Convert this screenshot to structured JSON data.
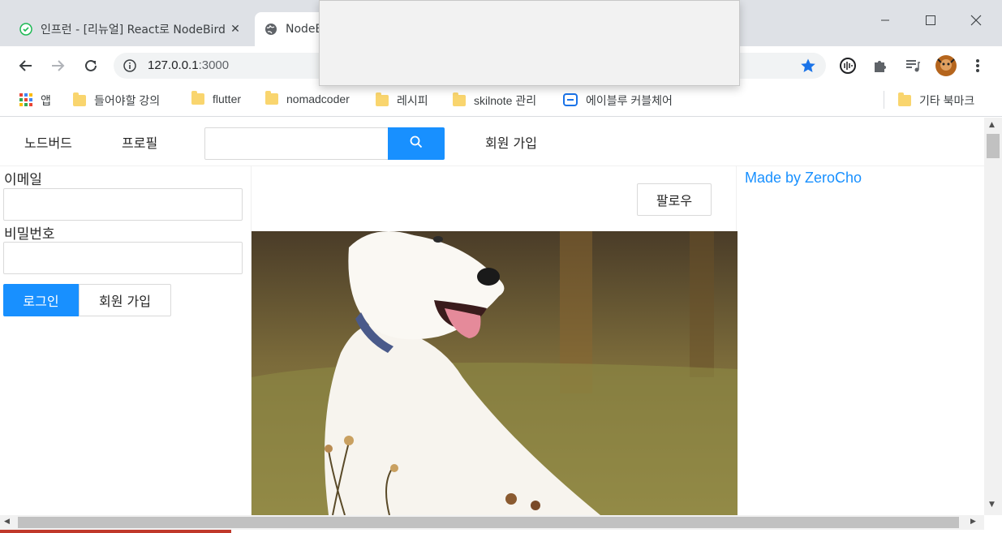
{
  "browser": {
    "tabs": [
      {
        "title": "인프런 - [리뉴얼] React로 NodeBird",
        "active": false
      },
      {
        "title": "NodeBird",
        "active": true
      }
    ],
    "url_host": "127.0.0.1",
    "url_port": ":3000",
    "bookmarks": [
      {
        "label": "앱",
        "icon": "apps-grid-icon"
      },
      {
        "label": "들어야할 강의",
        "icon": "folder-icon"
      },
      {
        "label": "flutter",
        "icon": "folder-icon"
      },
      {
        "label": "nomadcoder",
        "icon": "folder-icon"
      },
      {
        "label": "레시피",
        "icon": "folder-icon"
      },
      {
        "label": "skilnote 관리",
        "icon": "folder-icon"
      },
      {
        "label": "에이블루 커블체어",
        "icon": "site-icon"
      }
    ],
    "other_bookmarks": "기타 북마크",
    "accent": "#1a73e8"
  },
  "nav": {
    "home": "노드버드",
    "profile": "프로필",
    "search_placeholder": "",
    "signup": "회원 가입"
  },
  "login": {
    "email_label": "이메일",
    "email_value": "",
    "password_label": "비밀번호",
    "password_value": "",
    "login_button": "로그인",
    "signup_button": "회원 가입"
  },
  "post": {
    "follow_button": "팔로우",
    "image": "white-dog-photo"
  },
  "footer_link": "Made by ZeroCho",
  "colors": {
    "primary": "#1890ff",
    "border": "#d9d9d9"
  }
}
